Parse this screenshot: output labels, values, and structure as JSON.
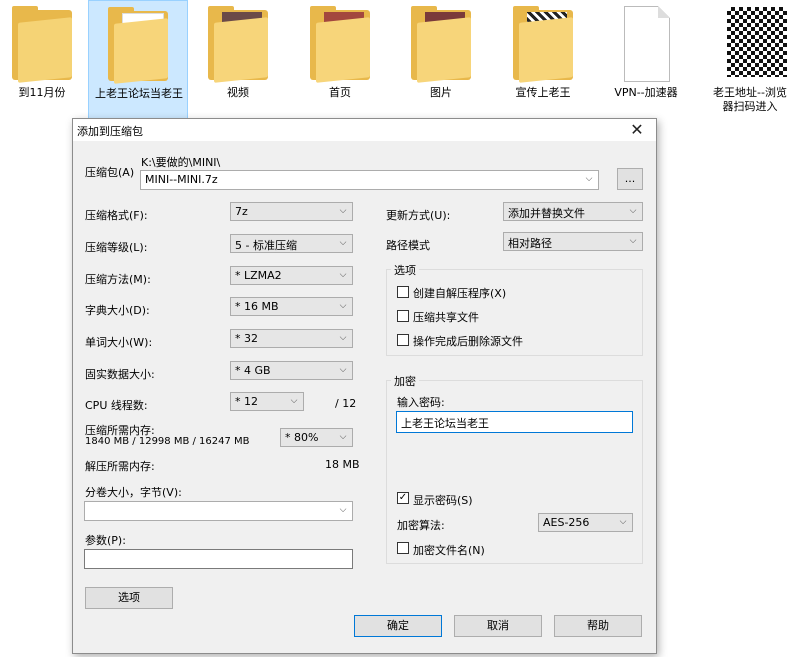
{
  "desktop": {
    "files": [
      {
        "name": "到11月份",
        "type": "folder-icon"
      },
      {
        "name": "上老王论坛当老王",
        "type": "folder-icon"
      },
      {
        "name": "视频",
        "type": "folder-icon"
      },
      {
        "name": "首页",
        "type": "folder-icon"
      },
      {
        "name": "图片",
        "type": "folder-icon"
      },
      {
        "name": "宣传上老王",
        "type": "folder-icon"
      },
      {
        "name": "VPN--加速器",
        "type": "document-icon"
      },
      {
        "name": "老王地址--浏览器扫码进入",
        "type": "qr-image-icon"
      }
    ],
    "selected_index": 1
  },
  "dialog": {
    "title": "添加到压缩包",
    "archive_label": "压缩包(A)",
    "archive_path": "K:\\要做的\\MINI\\",
    "archive_name": "MINI--MINI.7z",
    "browse_label": "...",
    "format_label": "压缩格式(F):",
    "format_value": "7z",
    "level_label": "压缩等级(L):",
    "level_value": "5 - 标准压缩",
    "method_label": "压缩方法(M):",
    "method_value": "* LZMA2",
    "dict_label": "字典大小(D):",
    "dict_value": "* 16 MB",
    "word_label": "单词大小(W):",
    "word_value": "* 32",
    "solid_label": "固实数据大小:",
    "solid_value": "* 4 GB",
    "cpu_label": "CPU 线程数:",
    "cpu_value": "* 12",
    "cpu_total": "/ 12",
    "mem_comp_label": "压缩所需内存:",
    "mem_comp_value": "1840 MB / 12998 MB / 16247 MB",
    "mem_percent": "* 80%",
    "mem_decomp_label": "解压所需内存:",
    "mem_decomp_value": "18 MB",
    "split_label": "分卷大小，字节(V):",
    "split_value": "",
    "params_label": "参数(P):",
    "params_value": "",
    "options_button": "选项",
    "update_label": "更新方式(U):",
    "update_value": "添加并替换文件",
    "path_label": "路径模式",
    "path_value": "相对路径",
    "options_group": "选项",
    "opt_sfx": "创建自解压程序(X)",
    "opt_shared": "压缩共享文件",
    "opt_delete": "操作完成后删除源文件",
    "encrypt_group": "加密",
    "password_label": "输入密码:",
    "password_value": "上老王论坛当老王",
    "show_password": "显示密码(S)",
    "show_password_checked": true,
    "enc_method_label": "加密算法:",
    "enc_method_value": "AES-256",
    "encrypt_names": "加密文件名(N)",
    "ok": "确定",
    "cancel": "取消",
    "help": "帮助",
    "close_glyph": "✕",
    "check_glyph": "✓",
    "dropdown_glyph": "⌵"
  }
}
